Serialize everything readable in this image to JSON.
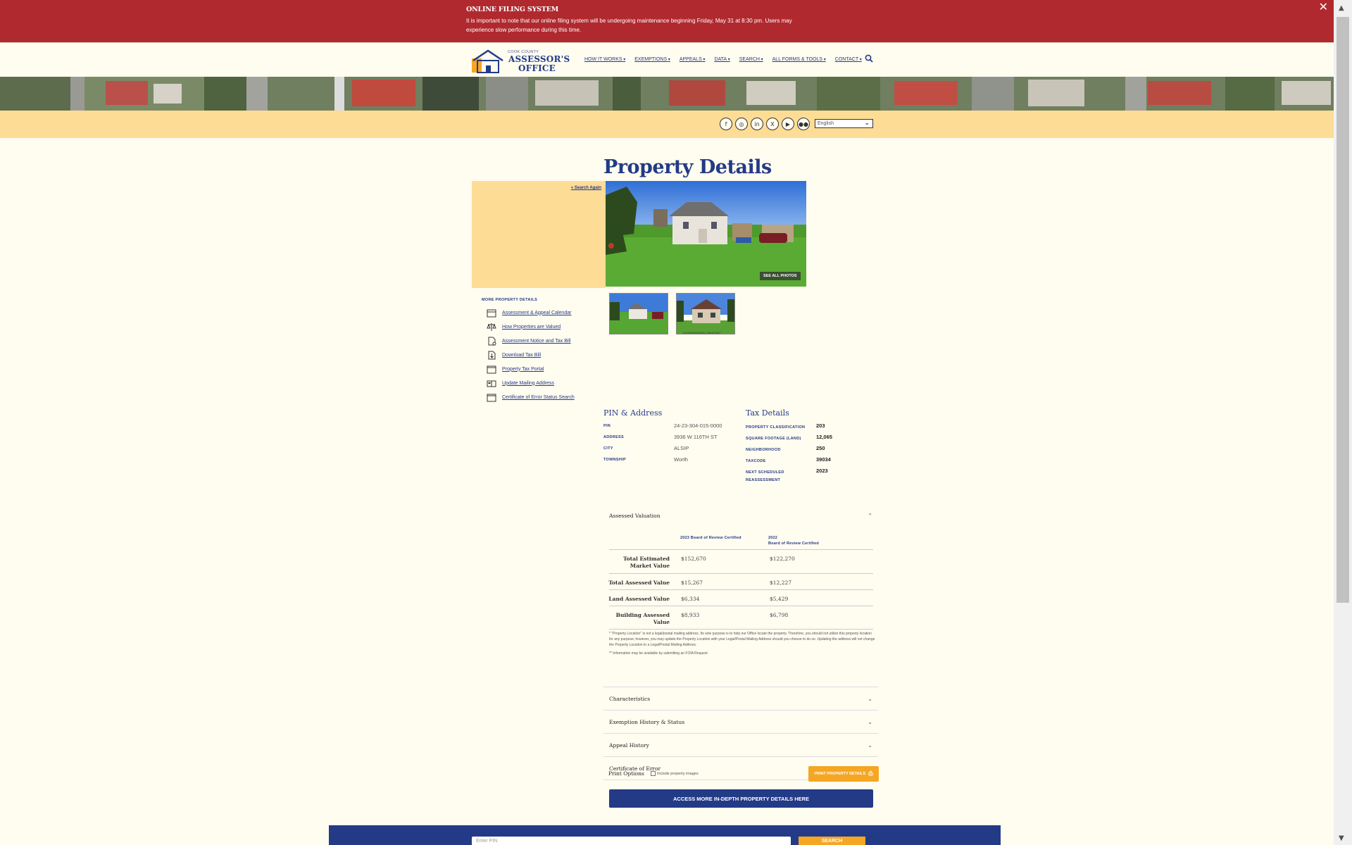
{
  "alert": {
    "title": "ONLINE FILING SYSTEM",
    "message": "It is important to note that our online filing system will be undergoing maintenance beginning Friday, May 31 at 8:30 pm. Users may experience slow performance during this time.",
    "close": "✕"
  },
  "logo": {
    "line1": "COOK COUNTY",
    "line2": "ASSESSOR'S",
    "line3": "OFFICE"
  },
  "nav": [
    "HOW IT WORKS",
    "EXEMPTIONS",
    "APPEALS",
    "DATA",
    "SEARCH",
    "ALL FORMS & TOOLS",
    "CONTACT"
  ],
  "social": {
    "icons": [
      "f",
      "◎",
      "in",
      "X",
      "▶",
      "●●"
    ],
    "language": "English"
  },
  "page_title": "Property Details",
  "search_again": "« Search Again",
  "see_all_photos": "SEE ALL PHOTOS",
  "thumb_caption": "24230404015000_08/19/2007",
  "more_details": {
    "title": "MORE PROPERTY DETAILS",
    "links": [
      "Assessment & Appeal Calendar",
      "How Properties are Valued",
      "Assessment Notice and Tax Bill",
      "Download Tax Bill",
      "Property Tax Portal",
      "Update Mailing Address",
      "Certificate of Error Status Search"
    ]
  },
  "pin_address": {
    "title": "PIN & Address",
    "rows": [
      {
        "k": "PIN",
        "v": "24-23-304-015-0000"
      },
      {
        "k": "ADDRESS",
        "v": "3936 W 116TH ST"
      },
      {
        "k": "CITY",
        "v": "ALSIP"
      },
      {
        "k": "TOWNSHIP",
        "v": "Worth"
      }
    ]
  },
  "tax_details": {
    "title": "Tax Details",
    "rows": [
      {
        "k": "PROPERTY CLASSIFICATION",
        "v": "203"
      },
      {
        "k": "SQUARE FOOTAGE (LAND)",
        "v": "12,065"
      },
      {
        "k": "NEIGHBORHOOD",
        "v": "250"
      },
      {
        "k": "TAXCODE",
        "v": "39034"
      },
      {
        "k": "NEXT SCHEDULED REASSESSMENT",
        "v": "2023"
      }
    ]
  },
  "valuation": {
    "title": "Assessed Valuation",
    "col1": "2023 Board of Review Certified",
    "col2_year": "2022",
    "col2": "Board of Review Certified",
    "rows": [
      {
        "label": "Total Estimated Market Value",
        "c1": "$152,670",
        "c2": "$122,270"
      },
      {
        "label": "Total Assessed Value",
        "c1": "$15,267",
        "c2": "$12,227"
      },
      {
        "label": "Land Assessed Value",
        "c1": "$6,334",
        "c2": "$5,429"
      },
      {
        "label": "Building Assessed Value",
        "c1": "$8,933",
        "c2": "$6,798"
      }
    ],
    "footnote1": "* \"Property Location\" is not a legal/postal mailing address. Its sole purpose is to help our Office locate the property. Therefore, you should not utilize this property location for any purpose; however, you may update the Property Location with your Legal/Postal Mailing Address should you choose to do so. Updating the address will not change the Property Location to a Legal/Postal Mailing Address.",
    "footnote2": "** Information may be available by submitting an FOIA Request"
  },
  "sections": [
    "Characteristics",
    "Exemption History & Status",
    "Appeal History",
    "Certificate of Error"
  ],
  "print": {
    "label": "Print Options",
    "checkbox": "Include property images",
    "button": "PRINT PROPERTY DETAILS"
  },
  "access_button": "ACCESS MORE IN-DEPTH PROPERTY DETAILS HERE",
  "footer": {
    "placeholder": "Enter PIN",
    "button": "SEARCH"
  }
}
